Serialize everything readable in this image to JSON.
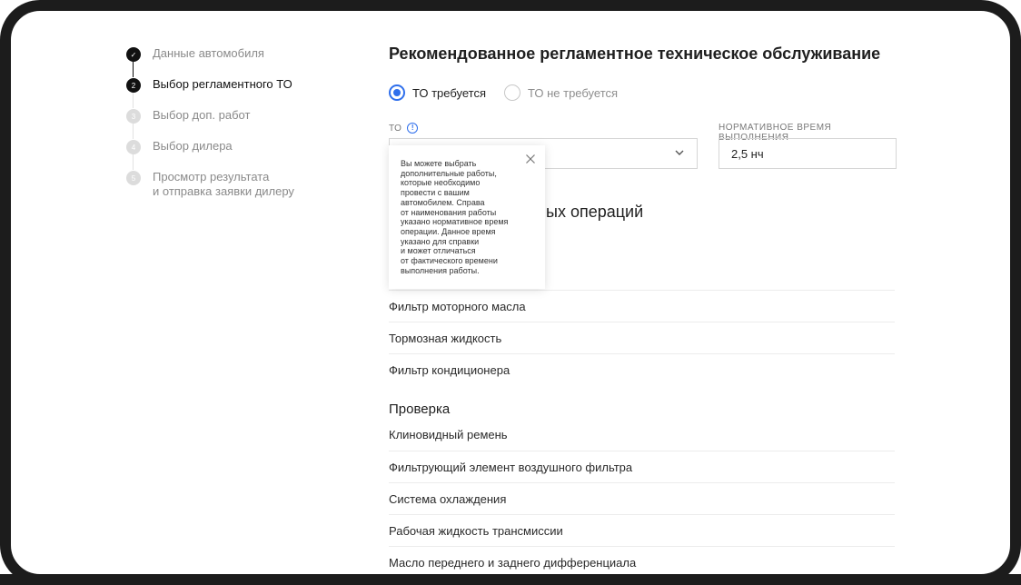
{
  "stepper": {
    "steps": [
      {
        "number": "✓",
        "label": "Данные автомобиля",
        "state": "done"
      },
      {
        "number": "2",
        "label": "Выбор регламентного ТО",
        "state": "active"
      },
      {
        "number": "3",
        "label": "Выбор доп. работ",
        "state": "pending"
      },
      {
        "number": "4",
        "label": "Выбор дилера",
        "state": "pending"
      },
      {
        "number": "5",
        "label": "Просмотр результата",
        "label2": "и отправка заявки дилеру",
        "state": "pending"
      }
    ]
  },
  "main": {
    "title": "Рекомендованное регламентное техническое обслуживание",
    "radio_required": "ТО требуется",
    "radio_not_required": "ТО не требуется",
    "to_label": "ТО",
    "norm_time_label": "НОРМАТИВНОЕ ВРЕМЯ ВЫПОЛНЕНИЯ",
    "norm_time_value": "2,5 нч",
    "operations_heading_visible": "ых операций",
    "replace_rows": [
      "Фильтр моторного масла",
      "Тормозная жидкость",
      "Фильтр кондиционера"
    ],
    "check_heading": "Проверка",
    "check_rows": [
      "Клиновидный ремень",
      "Фильтрующий элемент воздушного фильтра",
      "Система охлаждения",
      "Рабочая жидкость трансмиссии",
      "Масло переднего и заднего дифференциала"
    ]
  },
  "tooltip": {
    "lines": [
      "Вы можете выбрать",
      "дополнительные работы,",
      "которые необходимо",
      "провести с вашим",
      "автомобилем. Справа",
      "от наименования работы",
      "указано нормативное время",
      "операции. Данное время",
      "указано для справки",
      "и может отличаться",
      "от фактического времени",
      "выполнения работы."
    ]
  },
  "colors": {
    "accent": "#2f6fec",
    "frame": "#1c1c1c"
  }
}
